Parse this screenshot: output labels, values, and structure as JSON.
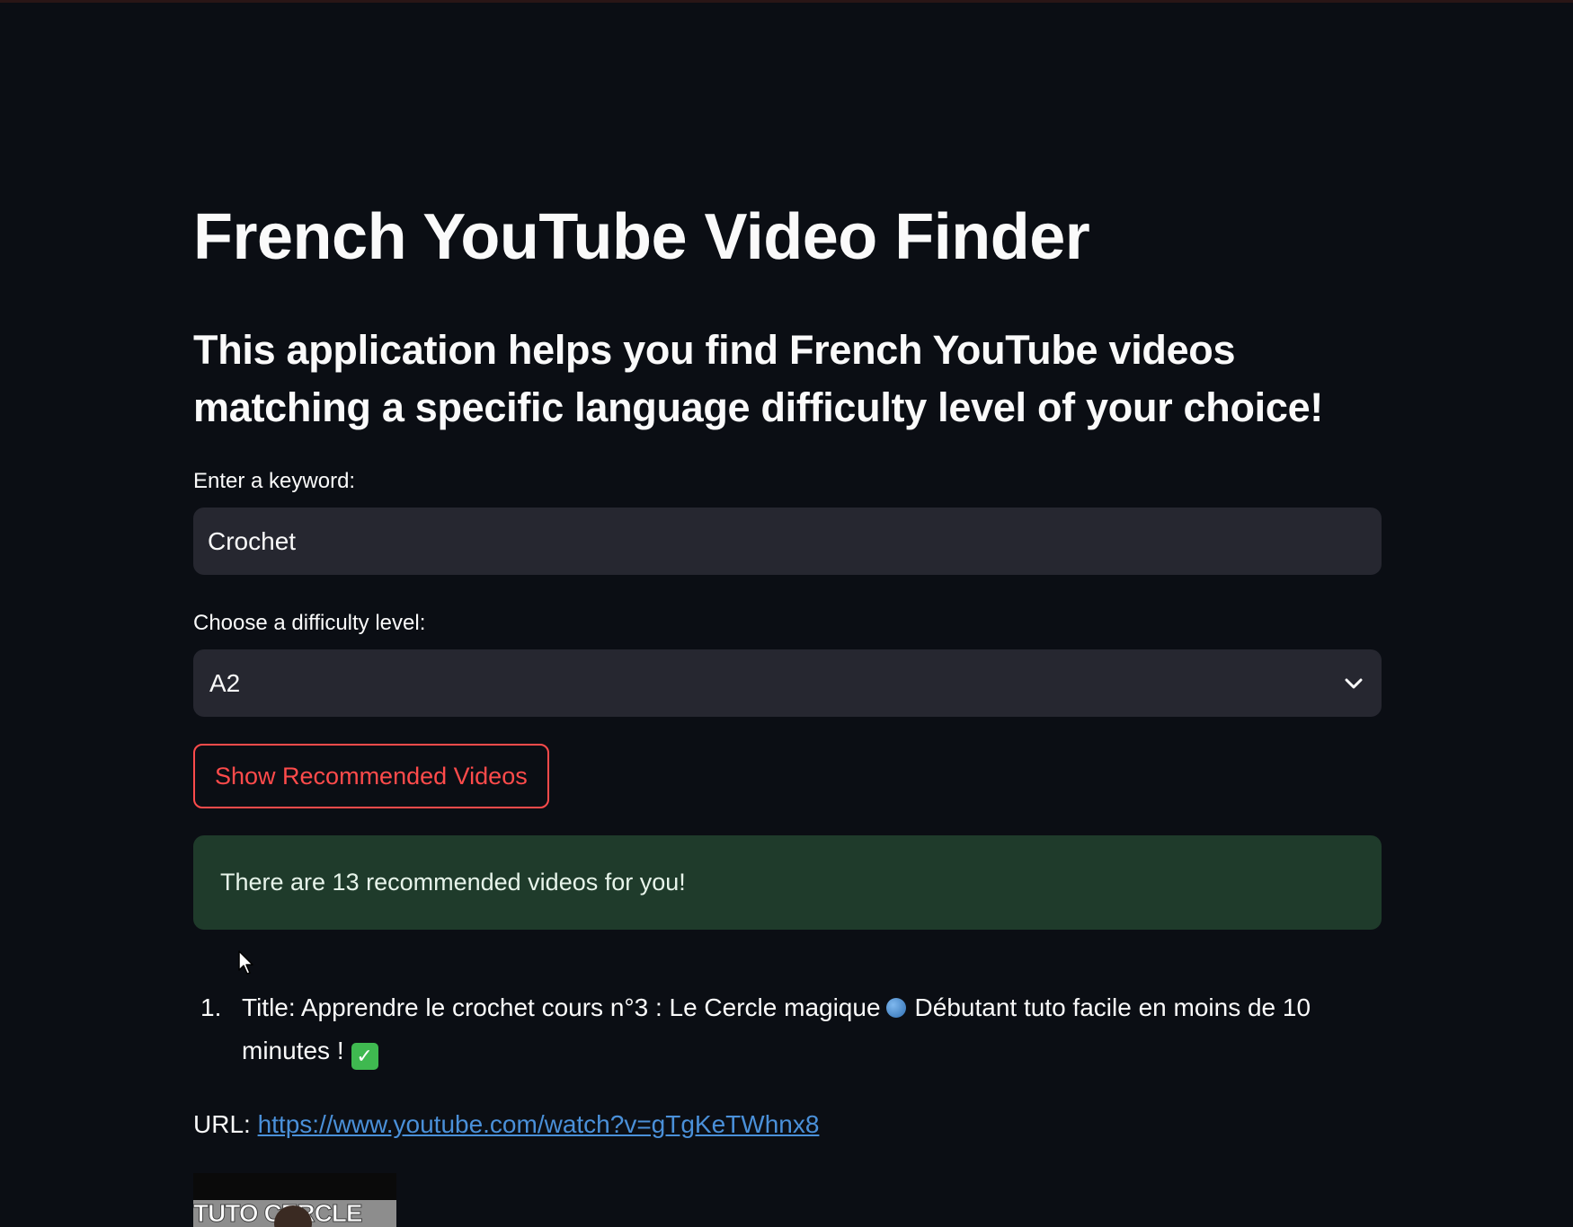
{
  "app": {
    "title": "French YouTube Video Finder",
    "subtitle": "This application helps you find French YouTube videos matching a specific language difficulty level of your choice!"
  },
  "keyword": {
    "label": "Enter a keyword:",
    "value": "Crochet"
  },
  "difficulty": {
    "label": "Choose a difficulty level:",
    "selected": "A2",
    "icon": "chevron-down-icon"
  },
  "button": {
    "label": "Show Recommended Videos"
  },
  "status": {
    "message": "There are 13 recommended videos for you!",
    "color": "#1f3b2b"
  },
  "results": [
    {
      "number": "1.",
      "title_part1": "Title: Apprendre le crochet cours n°3 : Le Cercle magique",
      "title_part2": "Débutant tuto facile en moins de 10 minutes !",
      "check_glyph": "✓",
      "url_label": "URL:",
      "url": "https://www.youtube.com/watch?v=gTgKeTWhnx8",
      "thumbnail_text": "TUTO CERCLE"
    }
  ],
  "colors": {
    "background": "#0b0e14",
    "accent": "#ff4b4b",
    "link": "#4a90d9",
    "input_bg": "#262730"
  }
}
